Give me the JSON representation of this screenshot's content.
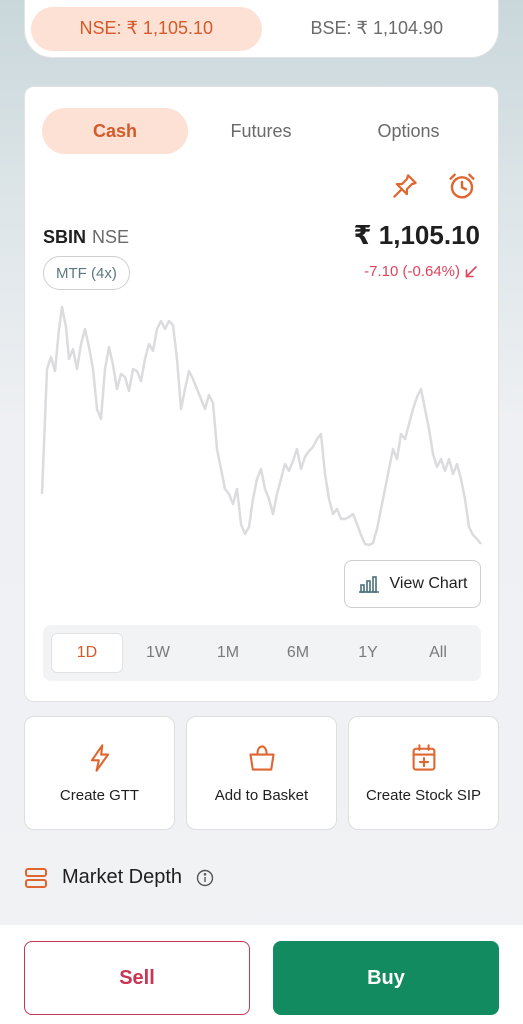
{
  "exchange": {
    "nse_label": "NSE:  ₹ 1,105.10",
    "bse_label": "BSE:  ₹ 1,104.90",
    "active": "NSE"
  },
  "segments": [
    {
      "label": "Cash",
      "active": true
    },
    {
      "label": "Futures",
      "active": false
    },
    {
      "label": "Options",
      "active": false
    }
  ],
  "stock": {
    "symbol": "SBIN",
    "exchange": "NSE",
    "price": "₹ 1,105.10",
    "mtf": "MTF (4x)",
    "change": "-7.10 (-0.64%)"
  },
  "chart": {
    "view_chart_label": "View Chart",
    "ranges": [
      "1D",
      "1W",
      "1M",
      "6M",
      "1Y",
      "All"
    ],
    "active_range": "1D"
  },
  "actions": [
    {
      "label": "Create GTT",
      "icon": "lightning-icon"
    },
    {
      "label": "Add to Basket",
      "icon": "basket-icon"
    },
    {
      "label": "Create Stock SIP",
      "icon": "calendar-plus-icon"
    }
  ],
  "market_depth": {
    "label": "Market Depth"
  },
  "trade": {
    "sell_label": "Sell",
    "buy_label": "Buy"
  },
  "colors": {
    "accent": "#d45a2a",
    "accent_bg": "#fce1d4",
    "sell": "#c93552",
    "buy": "#118b5f",
    "negative": "#e0445c"
  }
}
